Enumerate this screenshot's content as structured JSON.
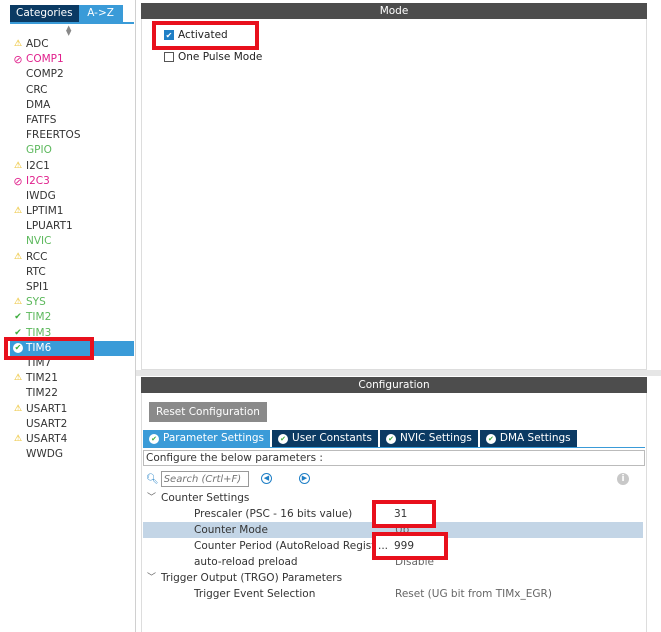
{
  "left_panel": {
    "tabs": [
      "Categories",
      "A->Z"
    ],
    "items": [
      {
        "label": "ADC",
        "status": "warning"
      },
      {
        "label": "COMP1",
        "status": "error"
      },
      {
        "label": "COMP2",
        "status": "none"
      },
      {
        "label": "CRC",
        "status": "none"
      },
      {
        "label": "DMA",
        "status": "none"
      },
      {
        "label": "FATFS",
        "status": "none"
      },
      {
        "label": "FREERTOS",
        "status": "none"
      },
      {
        "label": "GPIO",
        "status": "green"
      },
      {
        "label": "I2C1",
        "status": "warning"
      },
      {
        "label": "I2C3",
        "status": "error"
      },
      {
        "label": "IWDG",
        "status": "none"
      },
      {
        "label": "LPTIM1",
        "status": "warning"
      },
      {
        "label": "LPUART1",
        "status": "none"
      },
      {
        "label": "NVIC",
        "status": "green"
      },
      {
        "label": "RCC",
        "status": "warning"
      },
      {
        "label": "RTC",
        "status": "none"
      },
      {
        "label": "SPI1",
        "status": "none"
      },
      {
        "label": "SYS",
        "status": "warning-green"
      },
      {
        "label": "TIM2",
        "status": "ok"
      },
      {
        "label": "TIM3",
        "status": "ok"
      },
      {
        "label": "TIM6",
        "status": "selected"
      },
      {
        "label": "TIM7",
        "status": "none"
      },
      {
        "label": "TIM21",
        "status": "warning"
      },
      {
        "label": "TIM22",
        "status": "none"
      },
      {
        "label": "USART1",
        "status": "warning"
      },
      {
        "label": "USART2",
        "status": "none"
      },
      {
        "label": "USART4",
        "status": "warning"
      },
      {
        "label": "WWDG",
        "status": "none"
      }
    ]
  },
  "mode": {
    "title": "Mode",
    "activated_label": "Activated",
    "activated_checked": true,
    "one_pulse_label": "One Pulse Mode",
    "one_pulse_checked": false
  },
  "configuration": {
    "title": "Configuration",
    "reset_button": "Reset Configuration",
    "tabs": [
      "Parameter Settings",
      "User Constants",
      "NVIC Settings",
      "DMA Settings"
    ],
    "description": "Configure the below parameters :",
    "search_placeholder": "Search (Crtl+F)",
    "groups": [
      {
        "name": "Counter Settings",
        "params": [
          {
            "label": "Prescaler (PSC - 16 bits value)",
            "value": "31"
          },
          {
            "label": "Counter Mode",
            "value": "Up"
          },
          {
            "label": "Counter Period (AutoReload Register - ...",
            "value": "999"
          },
          {
            "label": "auto-reload preload",
            "value": "Disable"
          }
        ]
      },
      {
        "name": "Trigger Output (TRGO) Parameters",
        "params": [
          {
            "label": "Trigger Event Selection",
            "value": "Reset (UG bit from TIMx_EGR)"
          }
        ]
      }
    ]
  },
  "colors": {
    "accent": "#3a9bd8",
    "dark_tab": "#0b3a63",
    "header": "#4d4d4d",
    "highlight_box": "#e8101c",
    "warning": "#e8b400",
    "error": "#e0208c",
    "ok": "#5cb85c"
  }
}
